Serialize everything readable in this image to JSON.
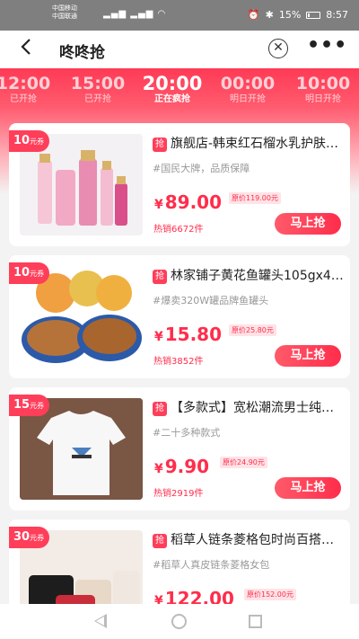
{
  "status_bar": {
    "carrier_1": "中国移动",
    "carrier_2": "中国联通",
    "battery": "15%",
    "time": "8:57"
  },
  "header": {
    "title": "咚咚抢"
  },
  "tabs": [
    {
      "time": "12:00",
      "status": "已开抢"
    },
    {
      "time": "15:00",
      "status": "已开抢"
    },
    {
      "time": "20:00",
      "status": "正在疯抢"
    },
    {
      "time": "00:00",
      "status": "明日开抢"
    },
    {
      "time": "10:00",
      "status": "明日开抢"
    }
  ],
  "products": [
    {
      "coupon_amount": "10",
      "coupon_unit": "元券",
      "tag": "抢",
      "title": "旗舰店-韩束红石榴水乳护肤…",
      "desc": "#国民大牌，品质保障",
      "currency": "¥",
      "price": "89.00",
      "original_price": "原价119.00元",
      "sold": "热销6672件",
      "button": "马上抢"
    },
    {
      "coupon_amount": "10",
      "coupon_unit": "元券",
      "tag": "抢",
      "title": "林家铺子黄花鱼罐头105gx4…",
      "desc": "#爆卖320W罐品牌鱼罐头",
      "currency": "¥",
      "price": "15.80",
      "original_price": "原价25.80元",
      "sold": "热销3852件",
      "button": "马上抢"
    },
    {
      "coupon_amount": "15",
      "coupon_unit": "元券",
      "tag": "抢",
      "title": "【多款式】宽松潮流男士纯…",
      "desc": "#二十多种款式",
      "currency": "¥",
      "price": "9.90",
      "original_price": "原价24.90元",
      "sold": "热销2919件",
      "button": "马上抢"
    },
    {
      "coupon_amount": "30",
      "coupon_unit": "元券",
      "tag": "抢",
      "title": "稻草人链条菱格包时尚百搭…",
      "desc": "#稻草人真皮链条菱格女包",
      "currency": "¥",
      "price": "122.00",
      "original_price": "原价152.00元",
      "sold": "",
      "button": ""
    }
  ]
}
